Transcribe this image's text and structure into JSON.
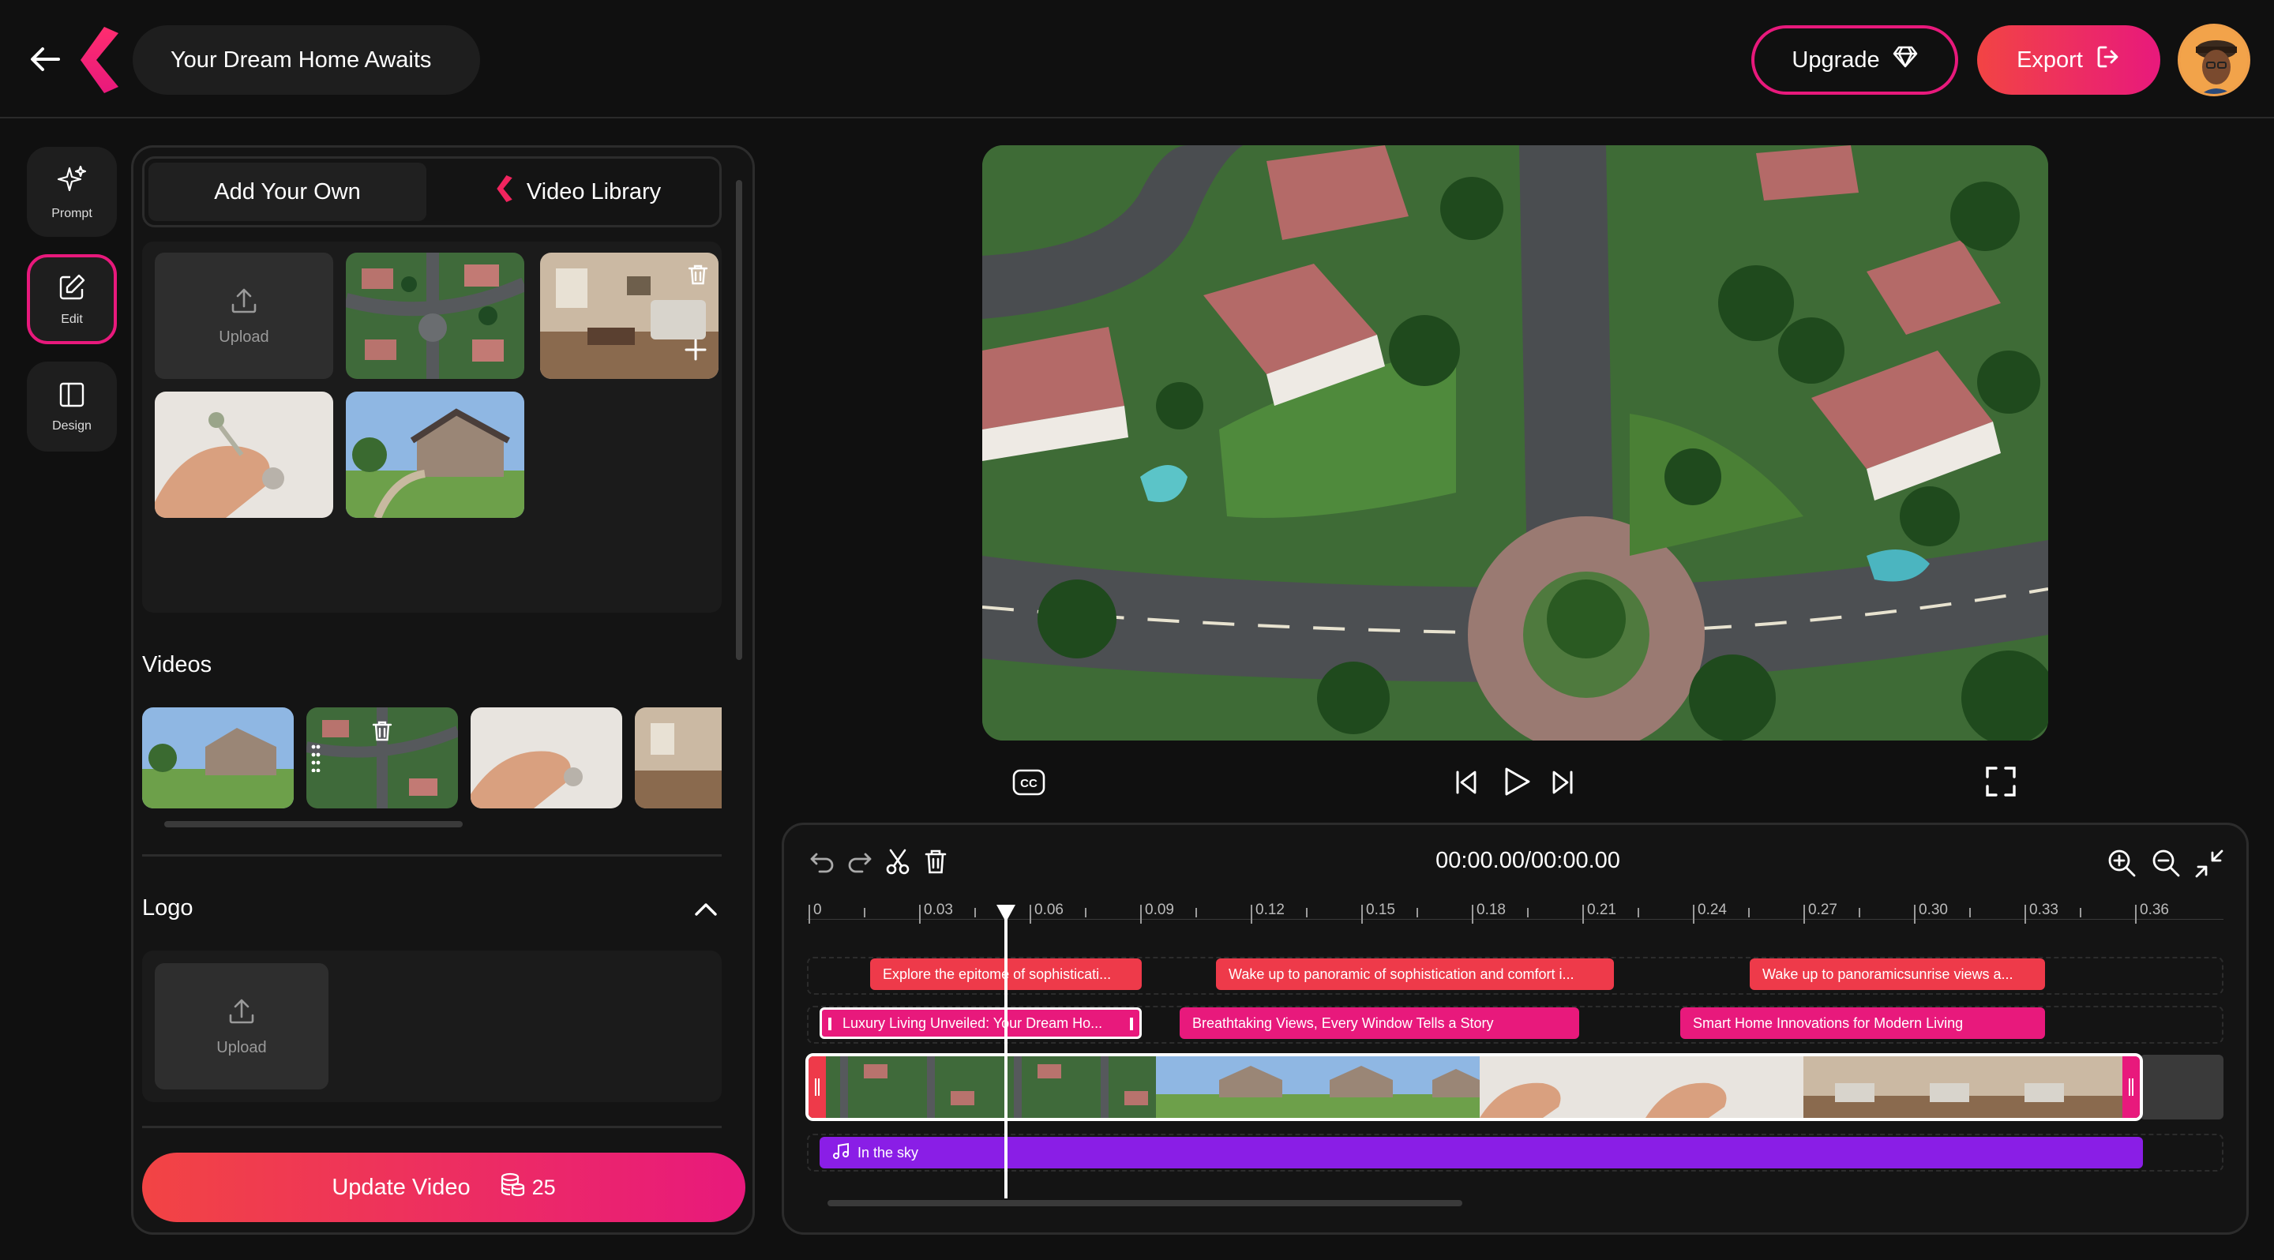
{
  "header": {
    "title": "Your Dream Home Awaits",
    "upgrade_label": "Upgrade",
    "export_label": "Export"
  },
  "rail": {
    "items": [
      {
        "label": "Prompt",
        "icon": "sparkle-icon"
      },
      {
        "label": "Edit",
        "icon": "edit-icon"
      },
      {
        "label": "Design",
        "icon": "layout-icon"
      }
    ]
  },
  "panel": {
    "tabs": [
      {
        "label": "Add Your Own"
      },
      {
        "label": "Video Library"
      }
    ],
    "upload_label": "Upload",
    "videos_heading": "Videos",
    "logo_heading": "Logo",
    "logo_upload_label": "Upload",
    "update_button_label": "Update Video",
    "credits": "25"
  },
  "player": {
    "cc_label": "CC"
  },
  "timeline": {
    "time": "00:00.00/00:00.00",
    "ticks": [
      "0",
      "0.03",
      "0.06",
      "0.09",
      "0.12",
      "0.15",
      "0.18",
      "0.21",
      "0.24",
      "0.27",
      "0.30",
      "0.33",
      "0.36"
    ],
    "subtitle_clips": [
      "Explore the epitome of sophisticati...",
      "Wake up to panoramic of sophistication and comfort i...",
      "Wake up to panoramicsunrise views a..."
    ],
    "title_clips": [
      "Luxury Living Unveiled: Your Dream Ho...",
      "Breathtaking Views, Every Window Tells a Story",
      "Smart Home Innovations for Modern Living"
    ],
    "music_label": "In the sky"
  },
  "colors": {
    "accent_pink": "#e8197c",
    "accent_red": "#ee3a4a",
    "music_purple": "#8a1ee6",
    "background": "#101010"
  }
}
